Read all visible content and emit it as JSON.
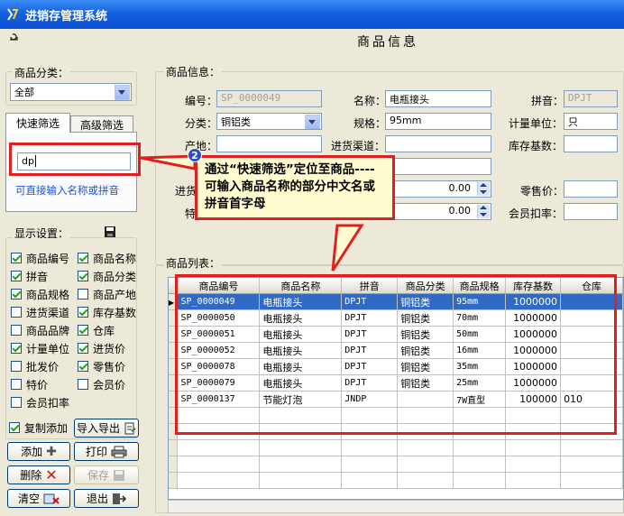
{
  "window": {
    "title": "进销存管理系统"
  },
  "page_title": "商品信息",
  "category": {
    "label": "商品分类：",
    "value": "全部"
  },
  "tabs": [
    {
      "label": "快速筛选"
    },
    {
      "label": "高级筛选"
    }
  ],
  "quick_filter": {
    "value": "dp",
    "hint": "可直接输入名称或拼音"
  },
  "display_settings": {
    "label": "显示设置：",
    "items": [
      {
        "label": "商品编号",
        "checked": true
      },
      {
        "label": "商品名称",
        "checked": true
      },
      {
        "label": "拼音",
        "checked": true
      },
      {
        "label": "商品分类",
        "checked": true
      },
      {
        "label": "商品规格",
        "checked": true
      },
      {
        "label": "商品产地",
        "checked": false
      },
      {
        "label": "进货渠道",
        "checked": false
      },
      {
        "label": "库存基数",
        "checked": true
      },
      {
        "label": "商品品牌",
        "checked": false
      },
      {
        "label": "仓库",
        "checked": true
      },
      {
        "label": "计量单位",
        "checked": true
      },
      {
        "label": "进货价",
        "checked": true
      },
      {
        "label": "批发价",
        "checked": false
      },
      {
        "label": "零售价",
        "checked": true
      },
      {
        "label": "特价",
        "checked": false
      },
      {
        "label": "会员价",
        "checked": false
      },
      {
        "label": "会员扣率",
        "checked": false
      }
    ]
  },
  "copy_add": {
    "label": "复制添加",
    "checked": true
  },
  "buttons": {
    "import_export": "导入导出",
    "add": "添加",
    "print": "打印",
    "delete": "删除",
    "save": "保存",
    "clear": "清空",
    "exit": "退出"
  },
  "info": {
    "group_label": "商品信息：",
    "code_label": "编号：",
    "code": "SP_0000049",
    "name_label": "名称：",
    "name": "电瓶接头",
    "pinyin_label": "拼音：",
    "pinyin": "DPJT",
    "class_label": "分类：",
    "class": "铜铝类",
    "spec_label": "规格：",
    "spec": "95mm",
    "unit_label": "计量单位：",
    "unit": "只",
    "origin_label": "产地：",
    "channel_label": "进货渠道：",
    "stock_label": "库存基数：",
    "in_price_label": "进货",
    "price1": "0.00",
    "retail_label": "零售价：",
    "special_label": "特",
    "price2": "0.00",
    "member_rate_label": "会员扣率："
  },
  "list": {
    "group_label": "商品列表：",
    "columns": [
      "商品编号",
      "商品名称",
      "拼音",
      "商品分类",
      "商品规格",
      "库存基数",
      "仓库"
    ],
    "rows": [
      [
        "SP_0000049",
        "电瓶接头",
        "DPJT",
        "铜铝类",
        "95mm",
        "1000000",
        ""
      ],
      [
        "SP_0000050",
        "电瓶接头",
        "DPJT",
        "铜铝类",
        "70mm",
        "1000000",
        ""
      ],
      [
        "SP_0000051",
        "电瓶接头",
        "DPJT",
        "铜铝类",
        "50mm",
        "1000000",
        ""
      ],
      [
        "SP_0000052",
        "电瓶接头",
        "DPJT",
        "铜铝类",
        "16mm",
        "1000000",
        ""
      ],
      [
        "SP_0000078",
        "电瓶接头",
        "DPJT",
        "铜铝类",
        "35mm",
        "1000000",
        ""
      ],
      [
        "SP_0000079",
        "电瓶接头",
        "DPJT",
        "铜铝类",
        "25mm",
        "1000000",
        ""
      ],
      [
        "SP_0000137",
        "节能灯泡",
        "JNDP",
        "",
        "7W直型",
        "100000",
        "010"
      ]
    ]
  },
  "annotation": {
    "badge": "2",
    "text": "通过“快速筛选”定位至商品----可输入商品名称的部分中文名或拼音首字母"
  }
}
